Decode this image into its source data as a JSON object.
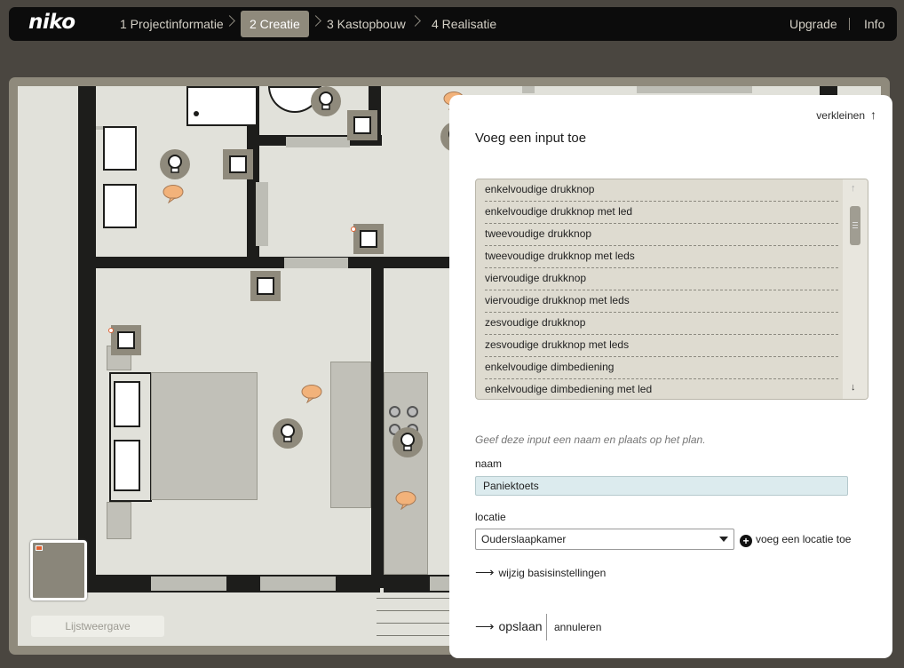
{
  "header": {
    "logo": "niko",
    "steps": [
      {
        "label": "1 Projectinformatie"
      },
      {
        "label": "2 Creatie"
      },
      {
        "label": "3 Kastopbouw"
      },
      {
        "label": "4 Realisatie"
      }
    ],
    "upgrade": "Upgrade",
    "info": "Info"
  },
  "plan": {
    "list_view_label": "Lijstweergave"
  },
  "panel": {
    "collapse_label": "verkleinen",
    "title": "Voeg een input toe",
    "inputs": [
      "enkelvoudige drukknop",
      "enkelvoudige drukknop met led",
      "tweevoudige drukknop",
      "tweevoudige drukknop met leds",
      "viervoudige drukknop",
      "viervoudige drukknop met leds",
      "zesvoudige drukknop",
      "zesvoudige drukknop met leds",
      "enkelvoudige dimbediening",
      "enkelvoudige dimbediening met led"
    ],
    "hint": "Geef deze input een naam en plaats op het plan.",
    "name_label": "naam",
    "name_value": "Paniektoets",
    "location_label": "locatie",
    "location_value": "Ouderslaapkamer",
    "add_location_label": "voeg een locatie toe",
    "basic_settings_label": "wijzig basisinstellingen",
    "save_label": "opslaan",
    "cancel_label": "annuleren"
  }
}
